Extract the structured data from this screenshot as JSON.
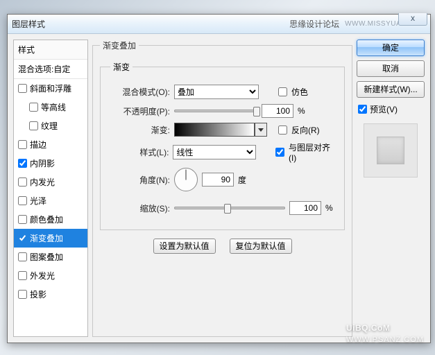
{
  "titlebar": {
    "title": "图层样式",
    "brand": "思缘设计论坛",
    "url": "WWW.MISSYUAN.COM",
    "close_glyph": "x"
  },
  "sidebar": {
    "heading": "样式",
    "subheading": "混合选项:自定",
    "items": [
      {
        "label": "斜面和浮雕",
        "checked": false,
        "indent": false
      },
      {
        "label": "等高线",
        "checked": false,
        "indent": true
      },
      {
        "label": "纹理",
        "checked": false,
        "indent": true
      },
      {
        "label": "描边",
        "checked": false,
        "indent": false
      },
      {
        "label": "内阴影",
        "checked": true,
        "indent": false
      },
      {
        "label": "内发光",
        "checked": false,
        "indent": false
      },
      {
        "label": "光泽",
        "checked": false,
        "indent": false
      },
      {
        "label": "颜色叠加",
        "checked": false,
        "indent": false
      },
      {
        "label": "渐变叠加",
        "checked": true,
        "indent": false,
        "selected": true
      },
      {
        "label": "图案叠加",
        "checked": false,
        "indent": false
      },
      {
        "label": "外发光",
        "checked": false,
        "indent": false
      },
      {
        "label": "投影",
        "checked": false,
        "indent": false
      }
    ]
  },
  "main": {
    "group_title": "渐变叠加",
    "inner_title": "渐变",
    "blend_label": "混合模式(O):",
    "blend_value": "叠加",
    "dither_label": "仿色",
    "dither_checked": false,
    "opacity_label": "不透明度(P):",
    "opacity_value": "100",
    "opacity_unit": "%",
    "opacity_pos_pct": 100,
    "gradient_label": "渐变:",
    "reverse_label": "反向(R)",
    "reverse_checked": false,
    "style_label": "样式(L):",
    "style_value": "线性",
    "align_label": "与图层对齐(I)",
    "align_checked": true,
    "angle_label": "角度(N):",
    "angle_value": "90",
    "angle_unit": "度",
    "scale_label": "缩放(S):",
    "scale_value": "100",
    "scale_unit": "%",
    "scale_pos_pct": 48,
    "btn_default": "设置为默认值",
    "btn_reset": "复位为默认值"
  },
  "right": {
    "ok": "确定",
    "cancel": "取消",
    "newstyle": "新建样式(W)...",
    "preview_label": "预览(V)",
    "preview_checked": true
  },
  "watermark": {
    "main": "UiBQ.CoM",
    "sub": "WWW.PSANZ.COM"
  }
}
